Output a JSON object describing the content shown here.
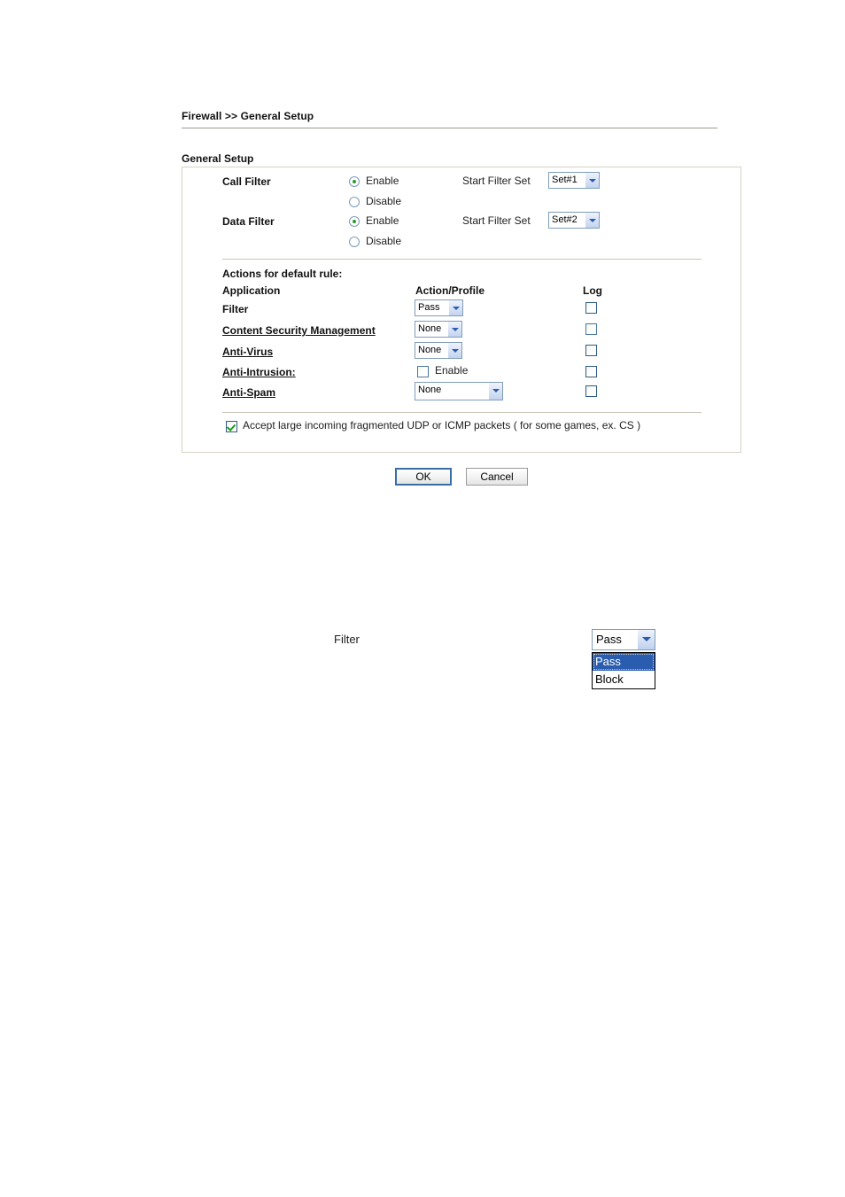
{
  "breadcrumb": "Firewall >> General Setup",
  "section_title": "General Setup",
  "filters": [
    {
      "name": "Call Filter",
      "enable_label": "Enable",
      "disable_label": "Disable",
      "selected": "Enable",
      "start_filter_set_label": "Start Filter Set",
      "start_filter_set_value": "Set#1"
    },
    {
      "name": "Data Filter",
      "enable_label": "Enable",
      "disable_label": "Disable",
      "selected": "Enable",
      "start_filter_set_label": "Start Filter Set",
      "start_filter_set_value": "Set#2"
    }
  ],
  "actions": {
    "heading": "Actions for default rule:",
    "columns": {
      "application": "Application",
      "action_profile": "Action/Profile",
      "log": "Log"
    },
    "rows": [
      {
        "application": "Filter",
        "is_link": false,
        "control": "select",
        "value": "Pass",
        "log_checked": false
      },
      {
        "application": "Content Security Management",
        "is_link": true,
        "control": "select",
        "value": "None",
        "log_checked": false
      },
      {
        "application": "Anti-Virus",
        "is_link": true,
        "control": "select",
        "value": "None",
        "log_checked": false
      },
      {
        "application": "Anti-Intrusion:",
        "is_link": true,
        "control": "checkbox",
        "value": "Enable",
        "checked": false,
        "log_checked": false
      },
      {
        "application": "Anti-Spam",
        "is_link": true,
        "control": "select-wide",
        "value": "None",
        "log_checked": false
      }
    ]
  },
  "accept_fragments": {
    "label": "Accept large incoming fragmented UDP or ICMP packets ( for some games, ex. CS )",
    "checked": true
  },
  "buttons": {
    "ok": "OK",
    "cancel": "Cancel"
  },
  "example": {
    "label": "Filter",
    "selected": "Pass",
    "options": [
      "Pass",
      "Block"
    ]
  },
  "colors": {
    "accent_blue": "#2a5db0",
    "check_green": "#19a019",
    "panel_border": "#d6d2c4",
    "control_border": "#7f9db9"
  }
}
